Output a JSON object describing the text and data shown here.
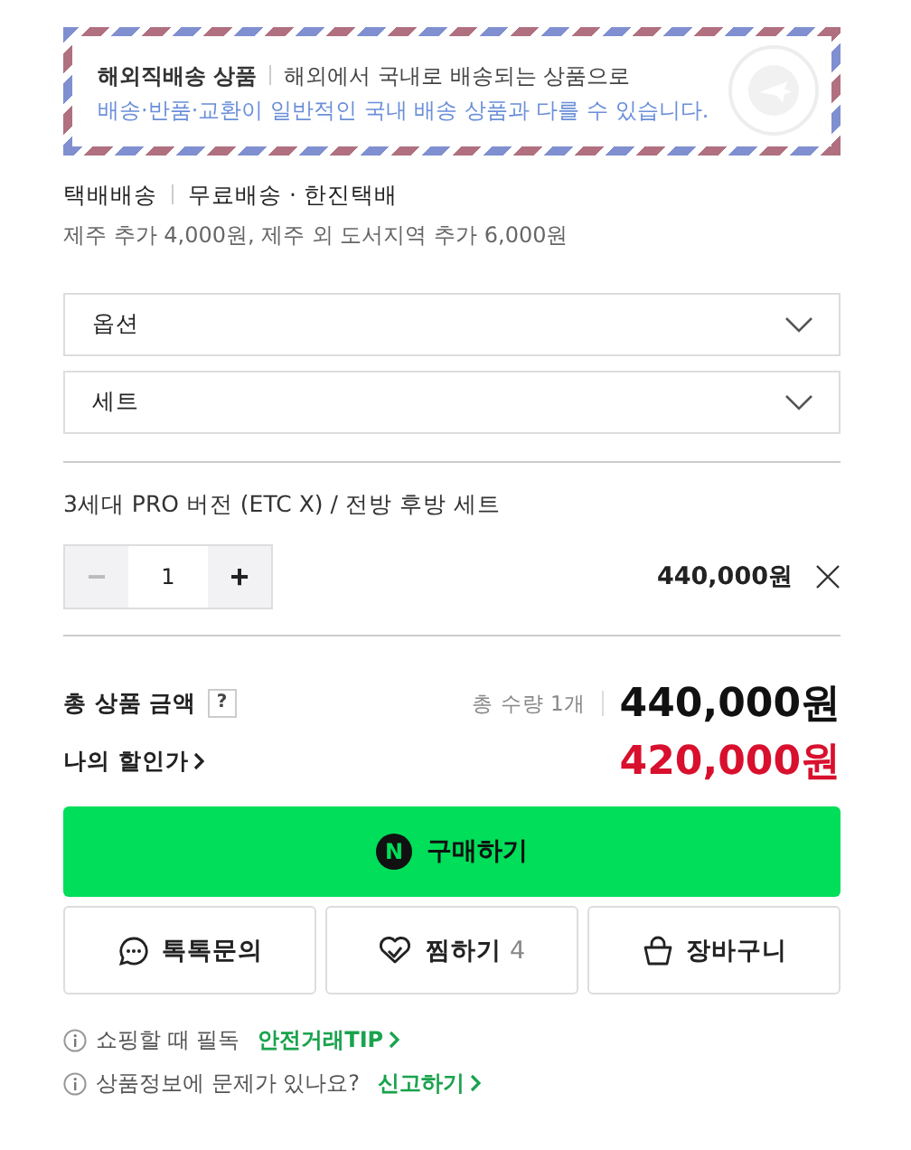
{
  "notice": {
    "title": "해외직배송 상품",
    "line1": "해외에서 국내로 배송되는 상품으로",
    "line2": "배송·반품·교환이 일반적인 국내 배송 상품과 다를 수 있습니다."
  },
  "shipping": {
    "method": "택배배송",
    "fee": "무료배송",
    "carrier": "· 한진택배",
    "extra": "제주 추가 4,000원, 제주 외 도서지역 추가 6,000원"
  },
  "selects": [
    {
      "label": "옵션"
    },
    {
      "label": "세트"
    }
  ],
  "item": {
    "name": "3세대 PRO 버전 (ETC X) / 전방 후방 세트",
    "minus": "−",
    "quantity": "1",
    "plus": "+",
    "minus_disabled": true,
    "price": "440,000원"
  },
  "totals": {
    "label": "총 상품 금액",
    "help": "?",
    "count": "총 수량 1개",
    "total": "440,000원",
    "discount_label": "나의 할인가",
    "discount": "420,000원"
  },
  "buy": {
    "logo": "N",
    "label": "구매하기"
  },
  "actions": [
    {
      "kind": "talk",
      "label": "톡톡문의"
    },
    {
      "kind": "wish",
      "label": "찜하기",
      "count": "4"
    },
    {
      "kind": "cart",
      "label": "장바구니"
    }
  ],
  "tips": [
    {
      "text": "쇼핑할 때 필독",
      "link": "안전거래TIP"
    },
    {
      "text": "상품정보에 문제가 있나요?",
      "link": "신고하기"
    }
  ]
}
